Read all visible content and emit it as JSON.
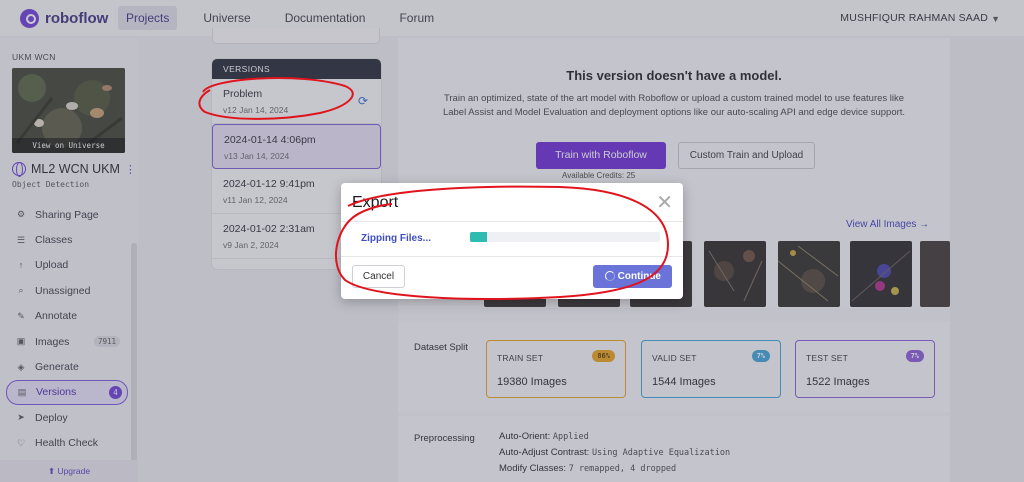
{
  "topbar": {
    "brand": "roboflow",
    "nav": [
      "Projects",
      "Universe",
      "Documentation",
      "Forum"
    ],
    "active_nav": "Projects",
    "user": "MUSHFIQUR RAHMAN SAAD"
  },
  "sidebar": {
    "workspace": "UKM WCN",
    "thumb_caption": "View on Universe",
    "project_name": "ML2 WCN UKM",
    "project_type": "Object Detection",
    "items": [
      {
        "label": "Sharing Page",
        "icon": "sharing-icon",
        "badge": ""
      },
      {
        "label": "Classes",
        "icon": "list-icon",
        "badge": ""
      },
      {
        "label": "Upload",
        "icon": "upload-icon",
        "badge": ""
      },
      {
        "label": "Unassigned",
        "icon": "search-icon",
        "badge": ""
      },
      {
        "label": "Annotate",
        "icon": "annotate-icon",
        "badge": ""
      },
      {
        "label": "Images",
        "icon": "image-icon",
        "badge": "7911"
      },
      {
        "label": "Generate",
        "icon": "generate-icon",
        "badge": ""
      },
      {
        "label": "Versions",
        "icon": "versions-icon",
        "badge": "4",
        "active": true
      },
      {
        "label": "Deploy",
        "icon": "deploy-icon",
        "badge": ""
      },
      {
        "label": "Health Check",
        "icon": "health-icon",
        "badge": ""
      }
    ],
    "upgrade": "Upgrade"
  },
  "versions": {
    "header": "VERSIONS",
    "list": [
      {
        "name": "Problem",
        "meta": "v12 Jan 14, 2024"
      },
      {
        "name": "2024-01-14 4:06pm",
        "meta": "v13 Jan 14, 2024"
      },
      {
        "name": "2024-01-12 9:41pm",
        "meta": "v11 Jan 12, 2024"
      },
      {
        "name": "2024-01-02 2:31am",
        "meta": "v9 Jan 2, 2024"
      }
    ]
  },
  "main": {
    "model_title": "This version doesn't have a model.",
    "model_desc": "Train an optimized, state of the art model with Roboflow or upload a custom trained model to use features like Label Assist and Model Evaluation and deployment options like our auto-scaling API and edge device support.",
    "train_button": "Train with Roboflow",
    "custom_button": "Custom Train and Upload",
    "credits": "Available Credits:  25",
    "view_all": "View All Images →",
    "split_label": "Dataset Split",
    "splits": [
      {
        "name": "TRAIN SET",
        "pct": "86%",
        "value": "19380",
        "unit": "Images",
        "color": "#e8a317"
      },
      {
        "name": "VALID SET",
        "pct": "7%",
        "value": "1544",
        "unit": "Images",
        "color": "#3aa3d8"
      },
      {
        "name": "TEST SET",
        "pct": "7%",
        "value": "1522",
        "unit": "Images",
        "color": "#8a5ad6"
      }
    ],
    "pre_label": "Preprocessing",
    "preprocessing": [
      {
        "key": "Auto-Orient:",
        "value": "Applied"
      },
      {
        "key": "Auto-Adjust Contrast:",
        "value": "Using Adaptive Equalization"
      },
      {
        "key": "Modify Classes:",
        "value": "7 remapped, 4 dropped"
      }
    ]
  },
  "modal": {
    "title": "Export",
    "status": "Zipping Files...",
    "progress": 0.09,
    "cancel": "Cancel",
    "continue": "Continue"
  },
  "colors": {
    "brand": "#6a2ad6",
    "annotation": "#e0141c",
    "progress": "#2fbcb0"
  }
}
